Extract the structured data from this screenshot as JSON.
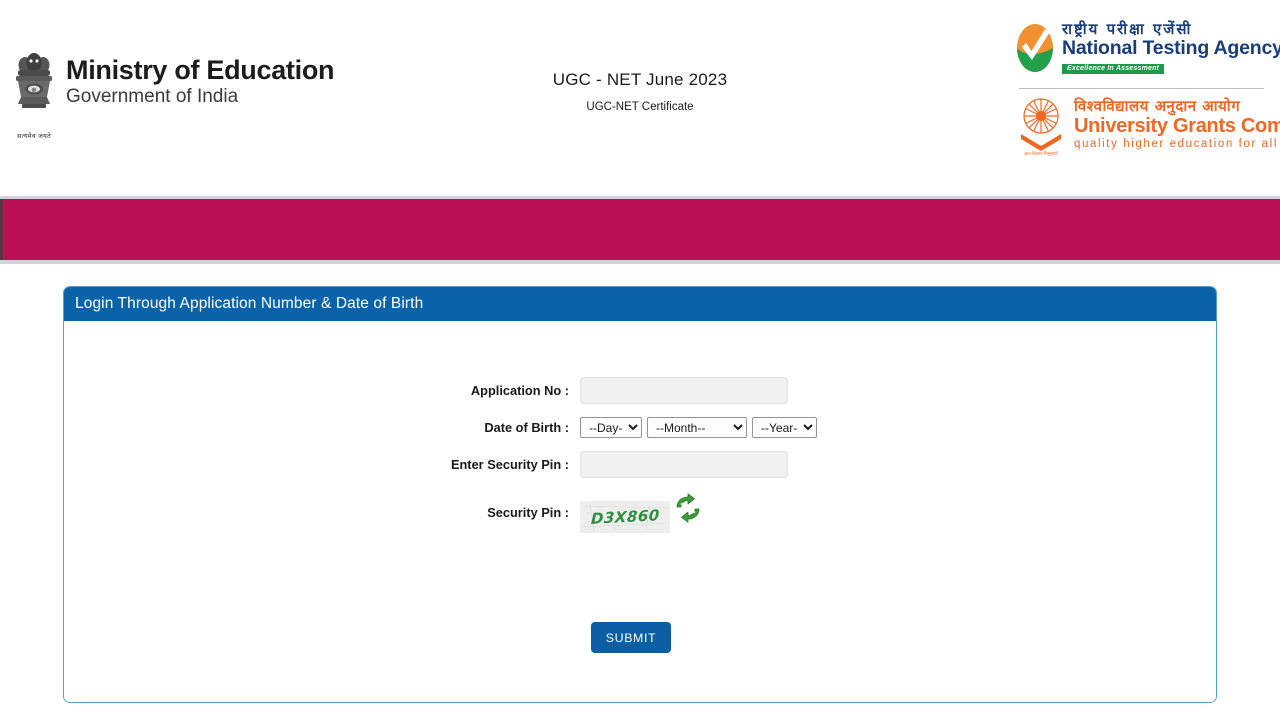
{
  "header": {
    "ministry": {
      "title": "Ministry of Education",
      "subtitle": "Government of India",
      "emblem_caption": "सत्यमेव जयते",
      "emblem_icon": "ashoka-lion-capital-icon"
    },
    "exam": {
      "title": "UGC - NET June 2023",
      "subtitle": "UGC-NET Certificate"
    },
    "nta": {
      "hindi": "राष्ट्रीय परीक्षा एजेंसी",
      "english": "National Testing Agency",
      "tagline": "Excellence In Assessment",
      "logo_icon": "nta-checkmark-icon"
    },
    "ugc": {
      "hindi": "विश्वविद्यालय अनुदान आयोग",
      "english": "University Grants Commission",
      "tagline": "quality  higher  education  for  all",
      "logo_icon": "ugc-chakra-icon"
    }
  },
  "navbar": {
    "items": [],
    "background_color": "#bb1055"
  },
  "panel": {
    "title": "Login Through Application Number & Date of Birth",
    "header_color": "#0a62a9",
    "border_color": "#5a9bd0"
  },
  "form": {
    "application_no": {
      "label": "Application No :",
      "value": "",
      "placeholder": ""
    },
    "date_of_birth": {
      "label": "Date of Birth :",
      "day": {
        "selected": "--Day--",
        "options": [
          "--Day--"
        ]
      },
      "month": {
        "selected": "--Month--",
        "options": [
          "--Month--"
        ]
      },
      "year": {
        "selected": "--Year--",
        "options": [
          "--Year--"
        ]
      }
    },
    "enter_security_pin": {
      "label": "Enter Security Pin :",
      "value": "",
      "placeholder": ""
    },
    "security_pin": {
      "label": "Security Pin :",
      "captcha_text": "D3X860",
      "captcha_color": "#2f8f3e",
      "refresh_icon": "refresh-circular-arrows-icon"
    },
    "submit": {
      "label": "SUBMIT",
      "color": "#0b5ea4"
    }
  }
}
